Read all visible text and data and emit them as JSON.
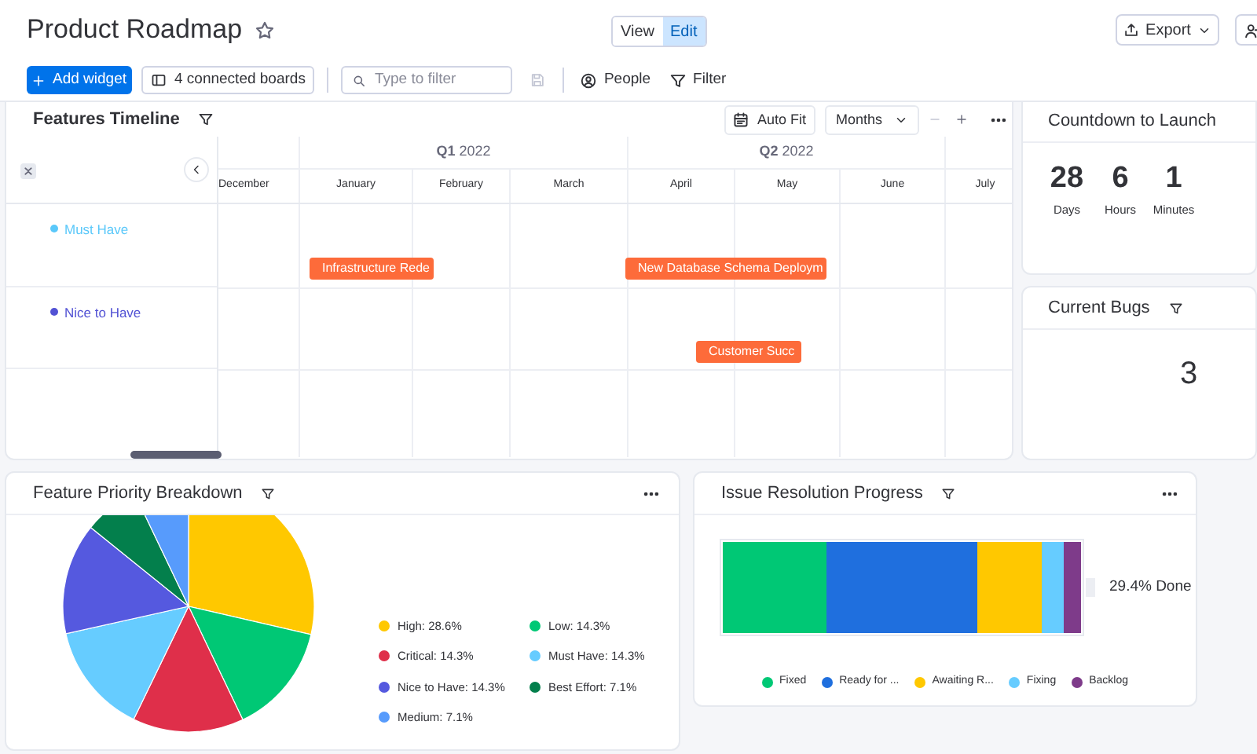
{
  "header": {
    "title": "Product Roadmap",
    "mode_tabs": [
      {
        "label": "View",
        "selected": false
      },
      {
        "label": "Edit",
        "selected": true
      }
    ],
    "export_label": "Export"
  },
  "toolbar": {
    "add_widget": "Add widget",
    "connected_boards": "4 connected boards",
    "search": {
      "placeholder": "Type to filter"
    },
    "people": "People",
    "filter": "Filter"
  },
  "features_timeline": {
    "title": "Features Timeline",
    "auto_fit": "Auto Fit",
    "zoom_select": "Months",
    "quarters": [
      "**Q1** 2022",
      "**Q2** 2022"
    ],
    "months": [
      "December",
      "January",
      "February",
      "March",
      "April",
      "May",
      "June",
      "July"
    ],
    "groups": [
      {
        "label": "Must Have",
        "color": "#5ac8fa",
        "bars": [
          "Infrastructure Rede",
          "New Database Schema Deploym"
        ]
      },
      {
        "label": "Nice to Have",
        "color": "#5252d4",
        "bars": [
          "Customer Succ"
        ]
      }
    ]
  },
  "countdown": {
    "title": "Countdown to Launch",
    "units": [
      {
        "value": "28",
        "label": "Days"
      },
      {
        "value": "6",
        "label": "Hours"
      },
      {
        "value": "1",
        "label": "Minutes"
      }
    ]
  },
  "current_bugs": {
    "title": "Current Bugs",
    "value": "3"
  },
  "feature_priority": {
    "title": "Feature Priority Breakdown",
    "chart_data": {
      "type": "pie",
      "categories": [
        "High: 28.6%",
        "Low: 14.3%",
        "Critical: 14.3%",
        "Must Have: 14.3%",
        "Nice to Have: 14.3%",
        "Best Effort: 7.1%",
        "Medium: 7.1%"
      ],
      "values": [
        28.6,
        14.3,
        14.3,
        14.3,
        14.3,
        7.1,
        7.1
      ]
    },
    "legend": [
      {
        "color": "#ffc800"
      },
      {
        "color": "#00c875"
      },
      {
        "color": "#df2f4a"
      },
      {
        "color": "#66ccff"
      },
      {
        "color": "#5559df"
      },
      {
        "color": "#037f4c"
      },
      {
        "color": "#579bfc"
      }
    ]
  },
  "issue_resolution": {
    "title": "Issue Resolution Progress",
    "done_label": "29.4% Done",
    "legend": [
      {
        "label": "Fixed",
        "color": "#00c875"
      },
      {
        "label": "Ready for ...",
        "color": "#1f6fde"
      },
      {
        "label": "Awaiting R...",
        "color": "#ffc800"
      },
      {
        "label": "Fixing",
        "color": "#66ccff"
      },
      {
        "label": "Backlog",
        "color": "#7e3b8a"
      }
    ]
  }
}
